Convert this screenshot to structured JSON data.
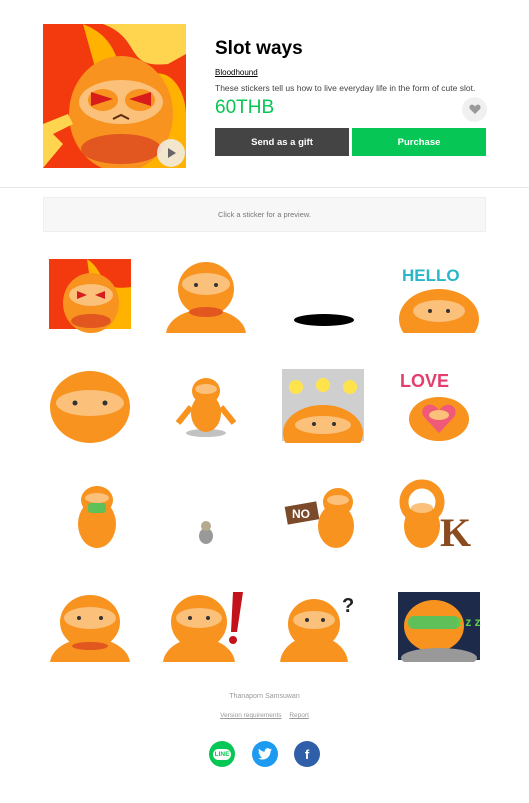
{
  "product": {
    "title": "Slot ways",
    "author": "Bloodhound",
    "description": "These stickers tell us how to live everyday life in the form of cute slot.",
    "price": "60THB",
    "gift_label": "Send as a gift",
    "purchase_label": "Purchase"
  },
  "preview": {
    "hint": "Click a sticker for a preview."
  },
  "stickers": {
    "row1": [
      "angry-sloth-fire",
      "sloth-smile",
      "black-hole",
      "sloth-hello"
    ],
    "row2": [
      "sloth-face-wink",
      "sloth-standing",
      "sloth-idea-bulbs",
      "sloth-love"
    ],
    "row3": [
      "sloth-mask",
      "small-sloth",
      "sloth-no-sign",
      "sloth-ok"
    ],
    "row4": [
      "sloth-content",
      "sloth-exclaim",
      "sloth-question",
      "sloth-sleep-mask"
    ],
    "hello_text": "HELLO",
    "love_text": "LOVE",
    "no_text": "NO",
    "ok_text": "K",
    "zzz_text": "z z z"
  },
  "footer": {
    "name": "Thanaporn Samsuwan",
    "link_version": "Version requirements",
    "link_report": "Report"
  },
  "social": {
    "line": "LINE",
    "twitter": "twitter",
    "facebook": "f"
  },
  "colors": {
    "brand_green": "#06c755",
    "sloth_orange": "#f7921e",
    "dark_button": "#444444"
  }
}
